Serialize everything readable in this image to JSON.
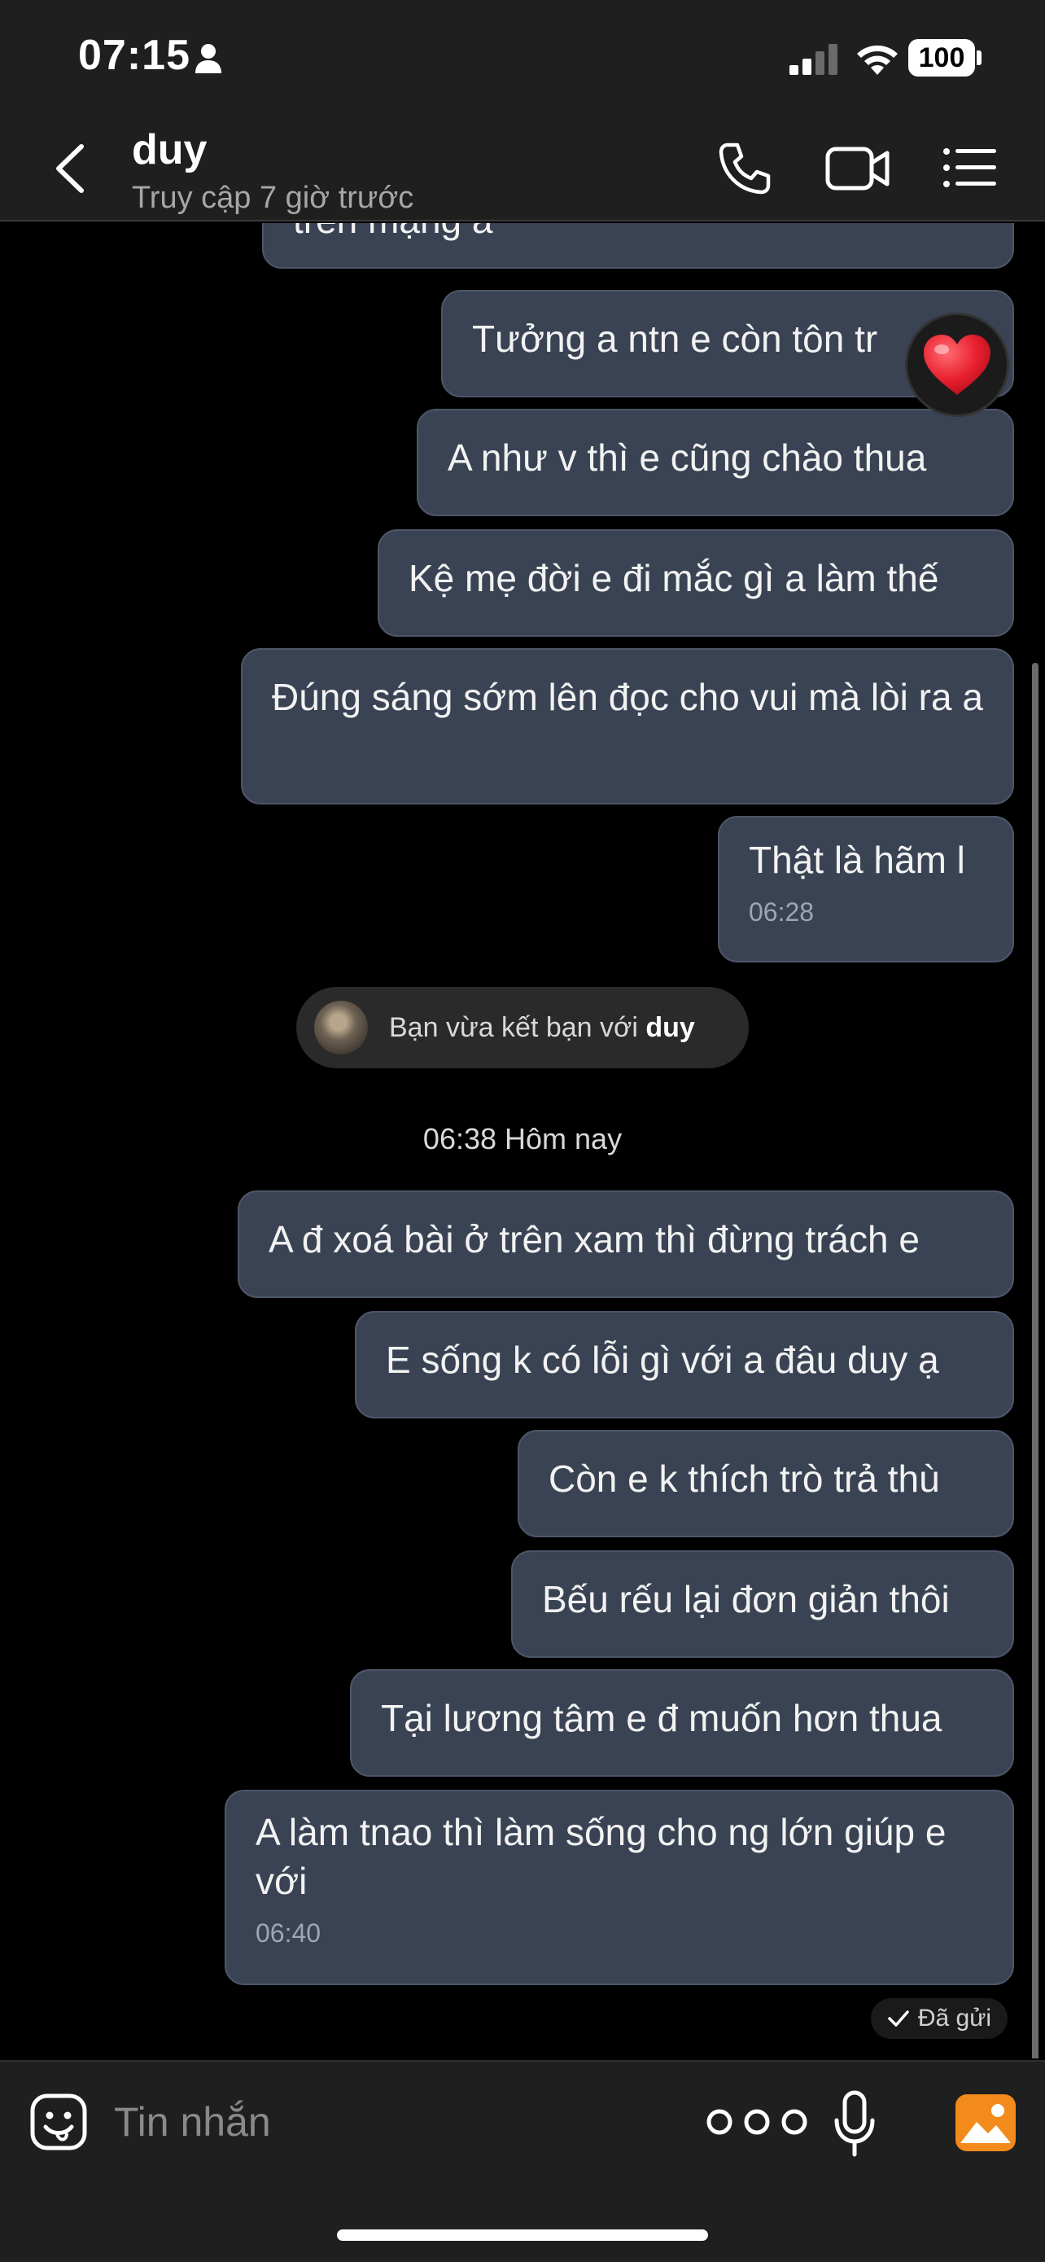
{
  "status_bar": {
    "time": "07:15",
    "battery": "100"
  },
  "header": {
    "contact_name": "duy",
    "contact_status": "Truy cập 7 giờ trước"
  },
  "messages": [
    {
      "text": "trên mạng a"
    },
    {
      "text": "Tưởng a ntn e còn tôn tr"
    },
    {
      "text": "A như v thì e cũng chào thua"
    },
    {
      "text": "Kệ mẹ đời e đi mắc gì a làm thế"
    },
    {
      "text": "Đúng sáng sớm lên đọc cho vui mà lòi ra a"
    },
    {
      "text": "Thật là hãm l",
      "time": "06:28"
    },
    {
      "text": "A đ xoá bài ở trên xam thì đừng trách e"
    },
    {
      "text": "E sống k có lỗi gì với a đâu duy ạ"
    },
    {
      "text": "Còn e k thích trò trả thù"
    },
    {
      "text": "Bếu rếu lại đơn giản thôi"
    },
    {
      "text": "Tại lương tâm e đ muốn hơn thua"
    },
    {
      "text": "A làm tnao thì làm sống cho ng lớn giúp e với",
      "time": "06:40"
    }
  ],
  "friend_notice": {
    "prefix": "Bạn vừa kết bạn với ",
    "name": "duy"
  },
  "date_separator": "06:38 Hôm nay",
  "sent_status": "Đã gửi",
  "composer": {
    "placeholder": "Tin nhắn"
  },
  "colors": {
    "bubble": "#3a4353",
    "accent_image_button": "#f28a1c",
    "heart": "#e8202e"
  }
}
